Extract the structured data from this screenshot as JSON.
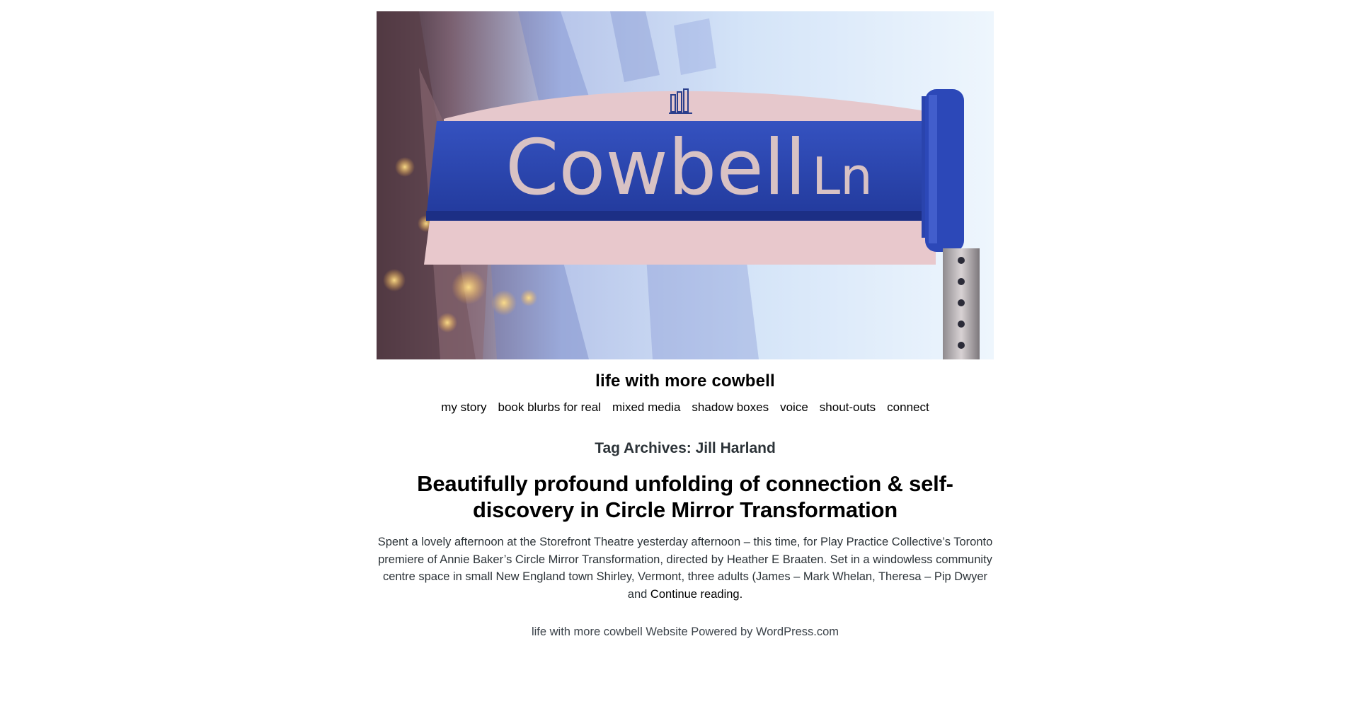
{
  "header_image": {
    "sign_text": "Cowbell",
    "sign_suffix": "Ln",
    "sign_color": "#2b46b0",
    "sky_color": "#cfe2f7"
  },
  "site": {
    "title": "life with more cowbell"
  },
  "nav": {
    "items": [
      {
        "label": "my story"
      },
      {
        "label": "book blurbs for real"
      },
      {
        "label": "mixed media"
      },
      {
        "label": "shadow boxes"
      },
      {
        "label": "voice"
      },
      {
        "label": "shout-outs"
      },
      {
        "label": "connect"
      }
    ]
  },
  "archive": {
    "title": "Tag Archives: Jill Harland"
  },
  "post": {
    "title": "Beautifully profound unfolding of connection & self-discovery in Circle Mirror Transformation",
    "excerpt": "Spent a lovely afternoon at the Storefront Theatre yesterday afternoon – this time, for Play Practice Collective’s Toronto premiere of Annie Baker’s Circle Mirror Transformation, directed by Heather E Braaten. Set in a windowless community centre space in small New England town Shirley, Vermont, three adults (James – Mark Whelan, Theresa – Pip Dwyer and ",
    "continue_label": "Continue reading",
    "continue_suffix": "."
  },
  "footer": {
    "site_link": "life with more cowbell Website",
    "powered_by": "Powered by WordPress.com"
  }
}
